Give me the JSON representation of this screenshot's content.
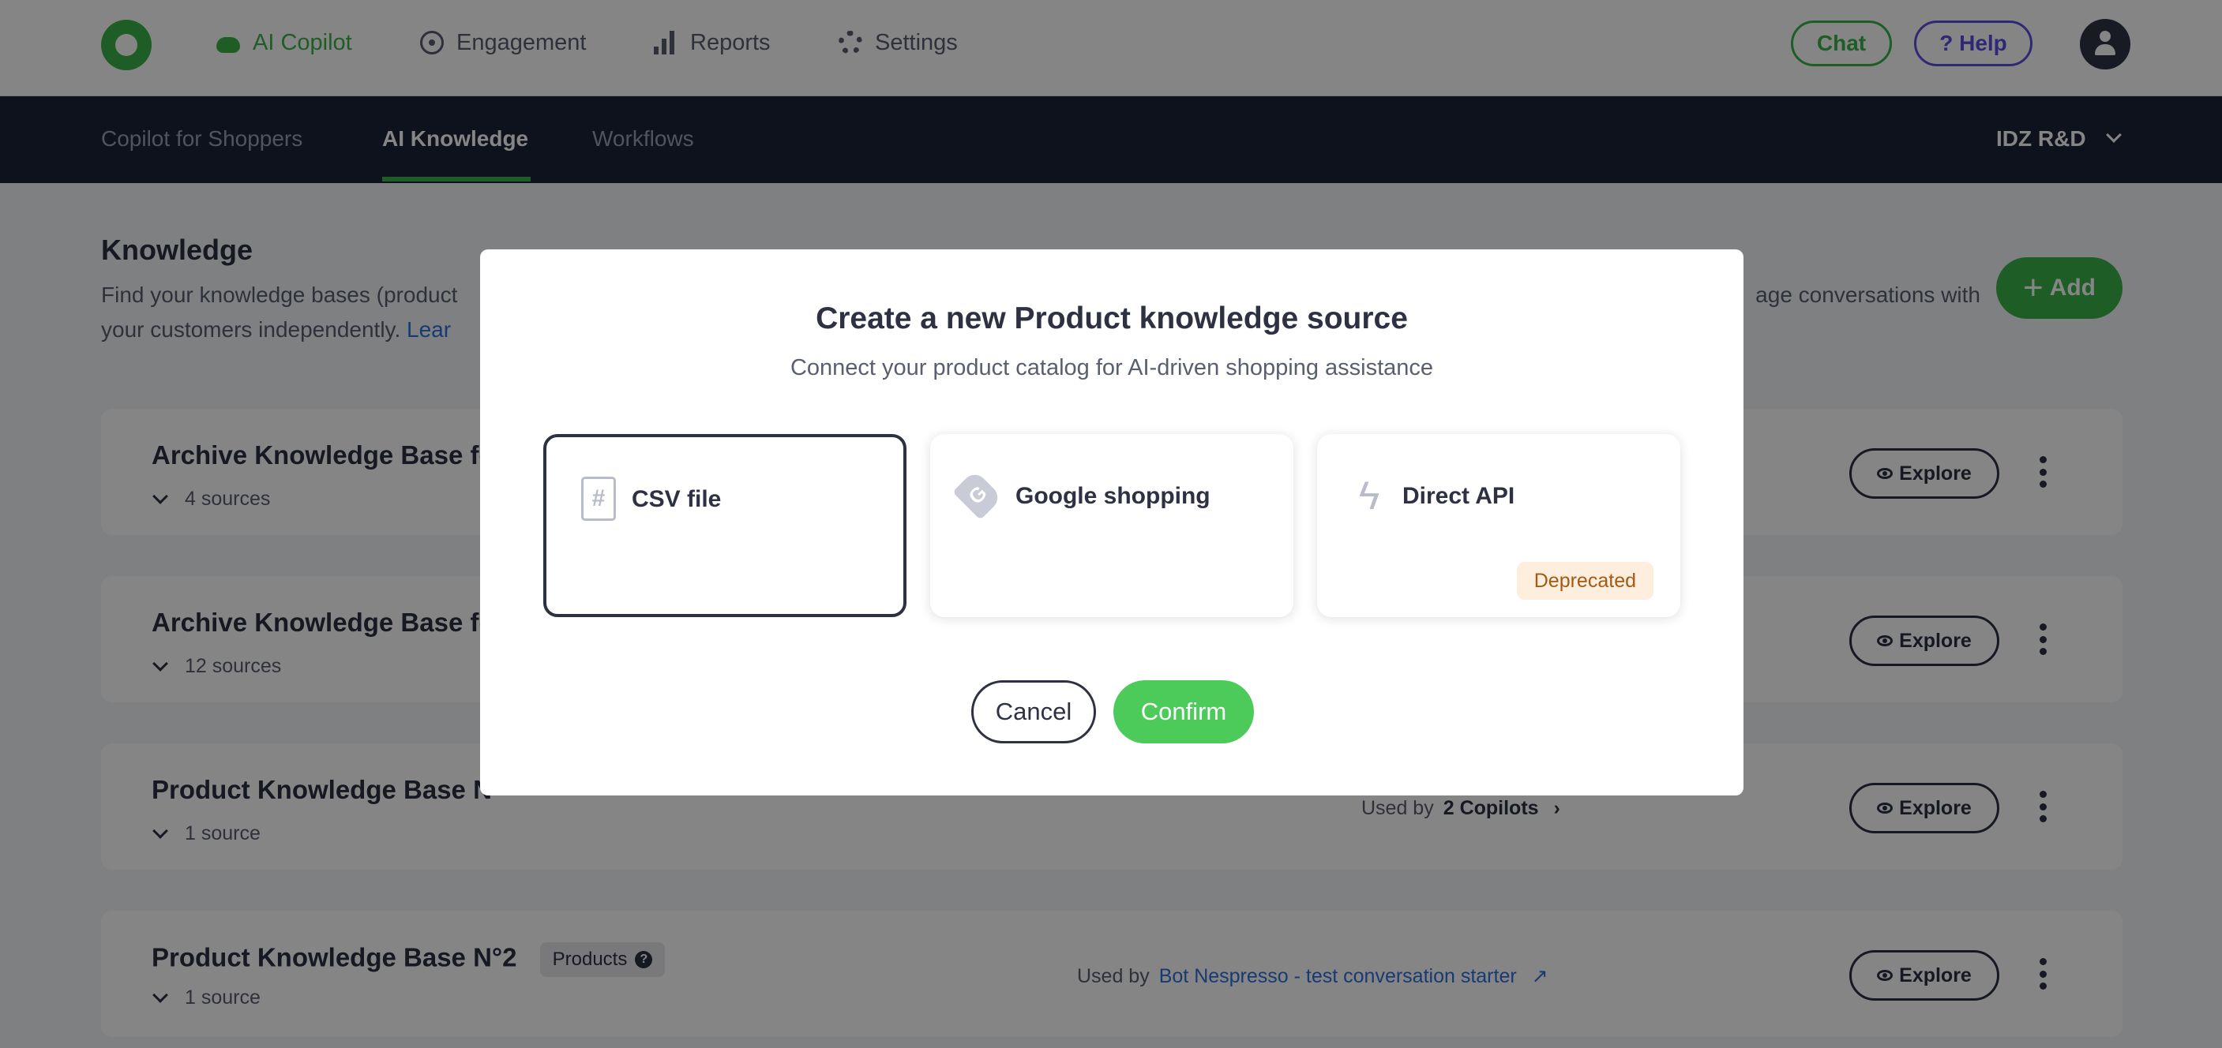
{
  "nav": {
    "items": [
      {
        "label": "AI Copilot",
        "icon": "cloud-icon",
        "active": true
      },
      {
        "label": "Engagement",
        "icon": "target-icon"
      },
      {
        "label": "Reports",
        "icon": "bar-chart-icon"
      },
      {
        "label": "Settings",
        "icon": "gear-icon"
      }
    ],
    "chat_label": "Chat",
    "help_label": "? Help"
  },
  "subnav": {
    "tabs": [
      {
        "label": "Copilot for Shoppers"
      },
      {
        "label": "AI Knowledge",
        "active": true
      },
      {
        "label": "Workflows"
      }
    ],
    "org": "IDZ R&D"
  },
  "page": {
    "title": "Knowledge",
    "desc_part1": "Find your knowledge bases (product",
    "desc_part2": "age conversations with",
    "desc_line2": "your customers independently.",
    "learn_link": "Lear",
    "add_label": "Add"
  },
  "knowledge_bases": [
    {
      "name": "Archive Knowledge Base fo",
      "sources": "4 sources",
      "explore": "Explore"
    },
    {
      "name": "Archive Knowledge Base fo",
      "sources": "12 sources",
      "explore": "Explore"
    },
    {
      "name": "Product Knowledge Base N°",
      "sources": "1 source",
      "explore": "Explore",
      "used_by_label": "Used by",
      "used_by_value": "2 Copilots"
    },
    {
      "name": "Product Knowledge Base N°2",
      "badge": "Products",
      "sources": "1 source",
      "explore": "Explore",
      "used_by_label": "Used by",
      "used_by_value": "Bot Nespresso - test conversation starter"
    }
  ],
  "modal": {
    "title": "Create a new Product knowledge source",
    "subtitle": "Connect your product catalog for AI-driven shopping assistance",
    "options": [
      {
        "label": "CSV file",
        "icon": "file-hash-icon",
        "selected": true
      },
      {
        "label": "Google shopping",
        "icon": "google-tag-icon"
      },
      {
        "label": "Direct API",
        "icon": "lightning-icon",
        "badge": "Deprecated"
      }
    ],
    "cancel_label": "Cancel",
    "confirm_label": "Confirm"
  },
  "colors": {
    "brand_green": "#3bb54a",
    "dark_navy": "#1b2338",
    "help_purple": "#5b4de0",
    "link_blue": "#2f6fdc"
  }
}
